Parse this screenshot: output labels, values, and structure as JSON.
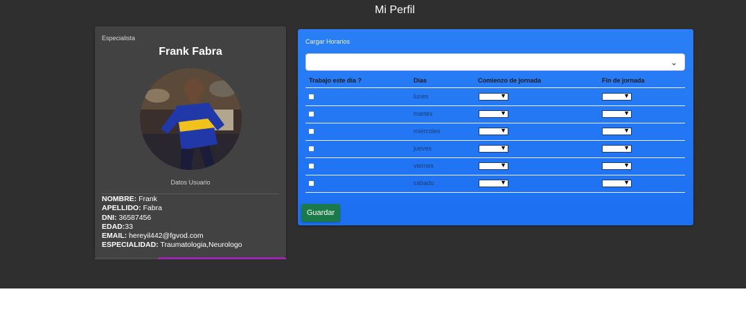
{
  "page": {
    "title": "Mi Perfil"
  },
  "profile": {
    "role": "Especialista",
    "name": "Frank Fabra",
    "section_label": "Datos Usuario",
    "fields": [
      {
        "label": "NOMBRE:",
        "value": " Frank"
      },
      {
        "label": "APELLIDO:",
        "value": " Fabra"
      },
      {
        "label": "DNI:",
        "value": " 36587456"
      },
      {
        "label": "EDAD:",
        "value": "33"
      },
      {
        "label": "EMAIL:",
        "value": " hereyil442@fgvod.com"
      },
      {
        "label": "ESPECIALIDAD:",
        "value": " Traumatologia,Neurologo"
      }
    ],
    "accent_color": "#9b27b0"
  },
  "schedule": {
    "title": "Cargar Horarios",
    "select_value": "",
    "columns": [
      "Trabajo este dia ?",
      "Dias",
      "Comienzo de jornada",
      "Fin de jornada"
    ],
    "days": [
      "lunes",
      "martes",
      "miércoles",
      "jueves",
      "viernes",
      "sábado"
    ],
    "save_label": "Guardar",
    "accent_color": "#1d6ff2",
    "button_color": "#1a7a4a"
  },
  "icons": [
    "chevron-down-icon",
    "avatar-photo"
  ]
}
